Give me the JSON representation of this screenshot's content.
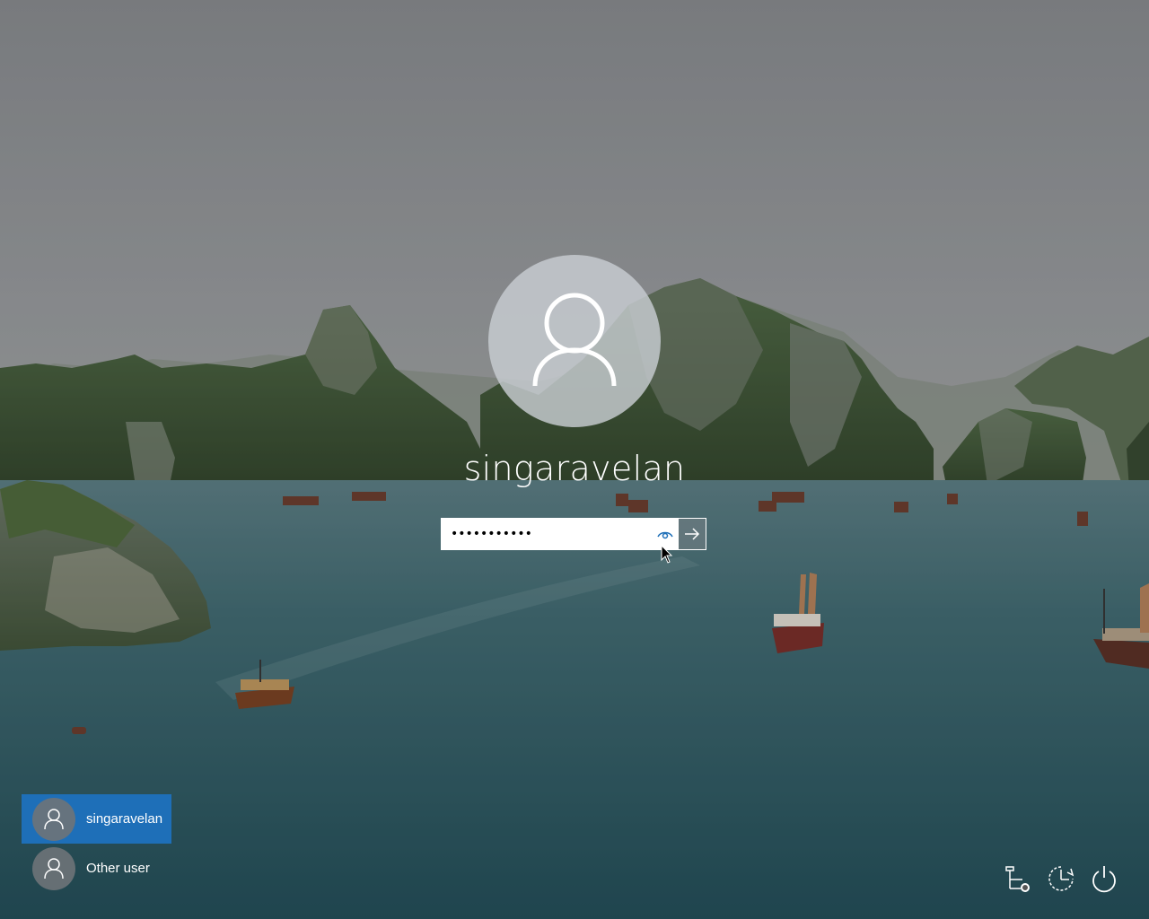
{
  "screen": {
    "type": "windows-lock-screen",
    "accent_color": "#1e6fb8"
  },
  "login": {
    "avatar_icon": "user-avatar-icon",
    "username": "singaravelan",
    "password_value": "•••••••••••",
    "reveal_icon": "eye-icon",
    "submit_icon": "arrow-right-icon"
  },
  "user_list": [
    {
      "name": "singaravelan",
      "selected": true,
      "icon": "user-avatar-icon"
    },
    {
      "name": "Other user",
      "selected": false,
      "icon": "user-avatar-icon"
    }
  ],
  "tray": {
    "network_icon": "network-icon",
    "ease_of_access_icon": "ease-of-access-icon",
    "power_icon": "power-icon"
  }
}
